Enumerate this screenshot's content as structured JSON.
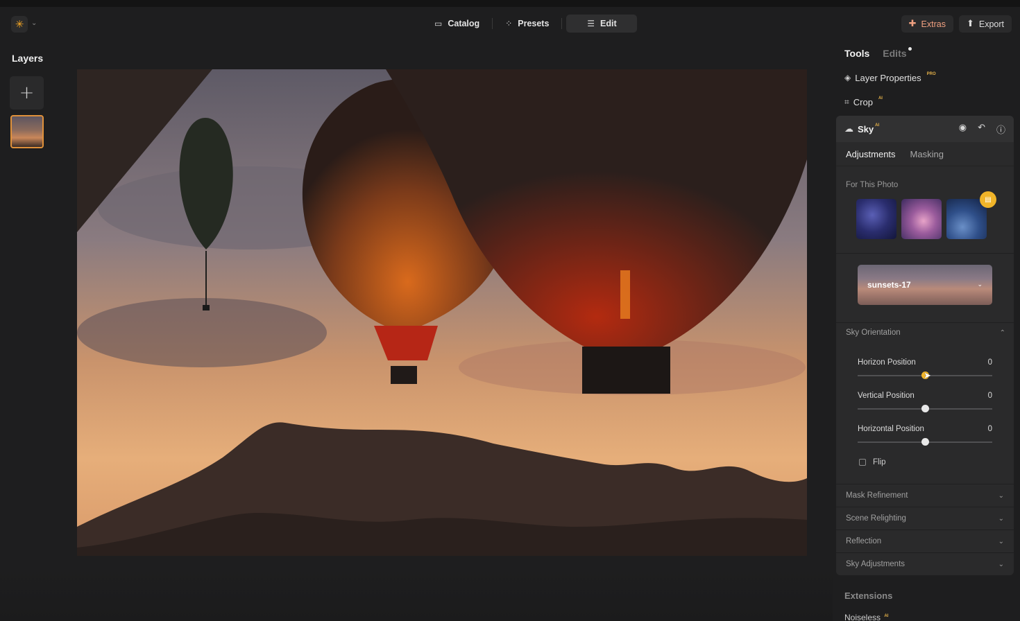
{
  "app": {
    "logo": "sun-logo-icon"
  },
  "nav": {
    "catalog": "Catalog",
    "presets": "Presets",
    "edit": "Edit"
  },
  "top_right": {
    "extras": "Extras",
    "export": "Export"
  },
  "layers": {
    "title": "Layers"
  },
  "photo": {
    "description_colors": {
      "sky_warm": "#e2a26f",
      "rock": "#3a2a25"
    }
  },
  "panel": {
    "tabs": {
      "tools": "Tools",
      "edits": "Edits"
    },
    "tools": [
      {
        "label": "Layer Properties",
        "badge": "PRO"
      },
      {
        "label": "Crop",
        "badge": "AI"
      }
    ],
    "sky": {
      "title": "Sky",
      "badge": "AI",
      "subtabs": {
        "adjustments": "Adjustments",
        "masking": "Masking"
      },
      "for_this_photo": "For This Photo",
      "selected_sky": "sunsets-17",
      "orientation": {
        "title": "Sky Orientation",
        "sliders": [
          {
            "label": "Horizon Position",
            "value": "0",
            "level": 0.5
          },
          {
            "label": "Vertical Position",
            "value": "0",
            "level": 0.5
          },
          {
            "label": "Horizontal Position",
            "value": "0",
            "level": 0.5
          }
        ],
        "flip": "Flip"
      },
      "collapsed_sections": [
        "Mask Refinement",
        "Scene Relighting",
        "Reflection",
        "Sky Adjustments"
      ]
    },
    "extensions": {
      "title": "Extensions",
      "first": "Noiseless",
      "first_badge": "AI"
    }
  },
  "accent_color": "#f0b429"
}
